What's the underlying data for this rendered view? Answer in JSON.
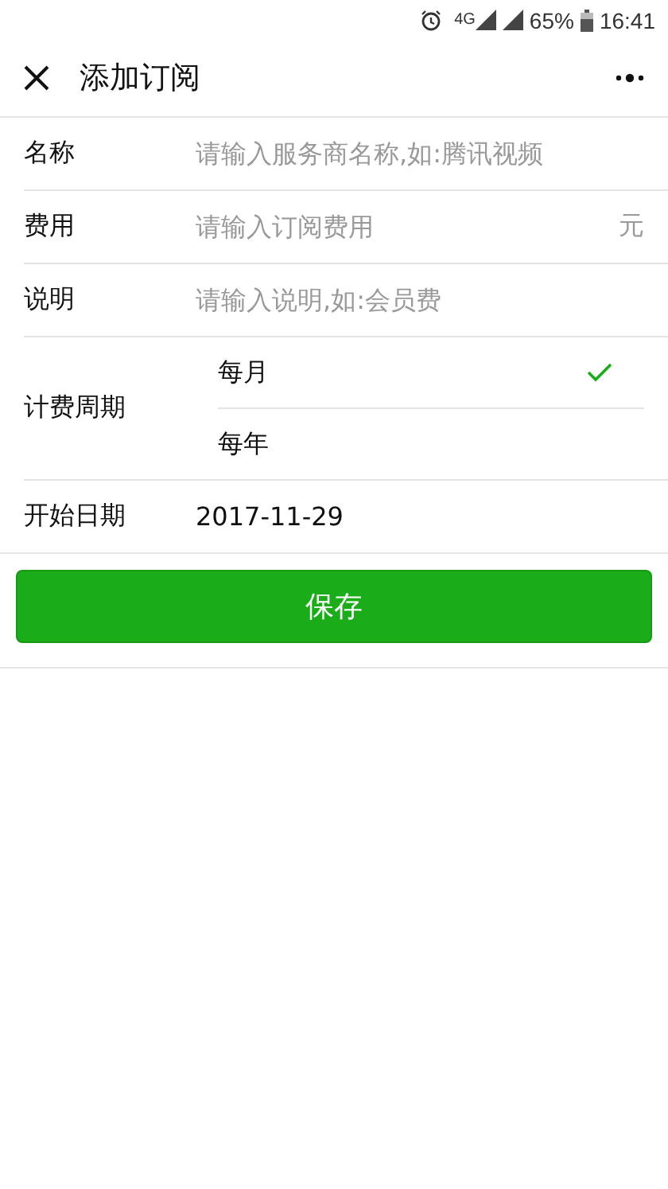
{
  "status_bar": {
    "network": "4G",
    "battery": "65%",
    "time": "16:41"
  },
  "nav": {
    "title": "添加订阅"
  },
  "fields": [
    {
      "label": "名称",
      "placeholder": "请输入服务商名称,如:腾讯视频"
    },
    {
      "label": "费用",
      "placeholder": "请输入订阅费用",
      "unit": "元"
    },
    {
      "label": "说明",
      "placeholder": "请输入说明,如:会员费"
    }
  ],
  "period": {
    "label": "计费周期",
    "options": [
      {
        "label": "每月",
        "selected": true
      },
      {
        "label": "每年",
        "selected": false
      }
    ]
  },
  "start_date": {
    "label": "开始日期",
    "value": "2017-11-29"
  },
  "save_button": "保存"
}
